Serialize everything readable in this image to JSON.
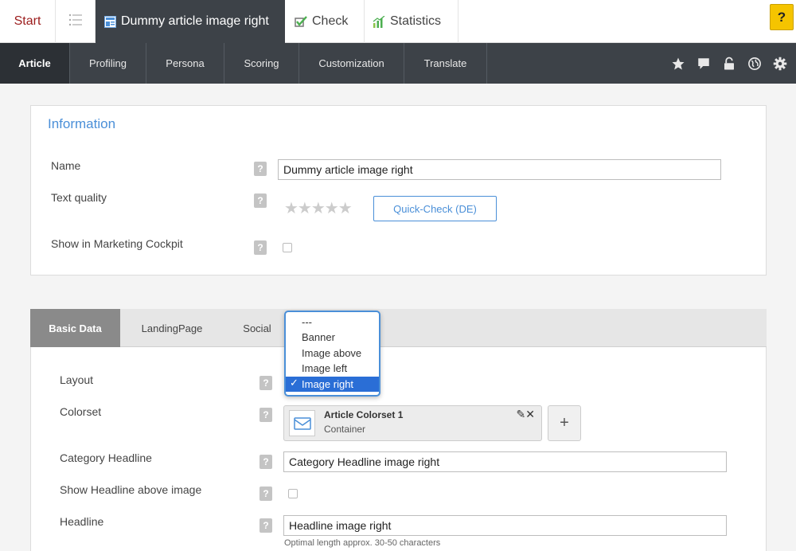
{
  "tabs": {
    "start": "Start",
    "active": "Dummy article image right",
    "check": "Check",
    "statistics": "Statistics",
    "help": "?"
  },
  "nav": {
    "items": [
      "Article",
      "Profiling",
      "Persona",
      "Scoring",
      "Customization",
      "Translate"
    ],
    "icons": [
      "star-icon",
      "comment-icon",
      "unlock-icon",
      "globe-icon",
      "gear-icon"
    ]
  },
  "info": {
    "title": "Information",
    "name_label": "Name",
    "name_value": "Dummy article image right",
    "quality_label": "Text quality",
    "stars": "★★★★★",
    "quick_check": "Quick-Check (DE)",
    "cockpit_label": "Show in Marketing Cockpit",
    "help": "?"
  },
  "subtabs": [
    "Basic Data",
    "LandingPage",
    "Social"
  ],
  "basic": {
    "layout_label": "Layout",
    "layout_options": [
      "---",
      "Banner",
      "Image above",
      "Image left",
      "Image right"
    ],
    "layout_selected": "Image right",
    "check_mark": "✓",
    "colorset_label": "Colorset",
    "colorset_name": "Article Colorset 1",
    "colorset_type": "Container",
    "colorset_actions": "✎✕",
    "plus": "+",
    "category_label": "Category Headline",
    "category_value": "Category Headline image right",
    "show_headline_label": "Show Headline above image",
    "headline_label": "Headline",
    "headline_value": "Headline image right",
    "headline_hint": "Optimal length approx. 30-50 characters"
  },
  "colors": {
    "accent": "#4a8fd8",
    "nav_bg": "#3d4248",
    "help_btn": "#f5c400",
    "start_tab": "#9b1c1c",
    "selected": "#2a6ed6"
  }
}
